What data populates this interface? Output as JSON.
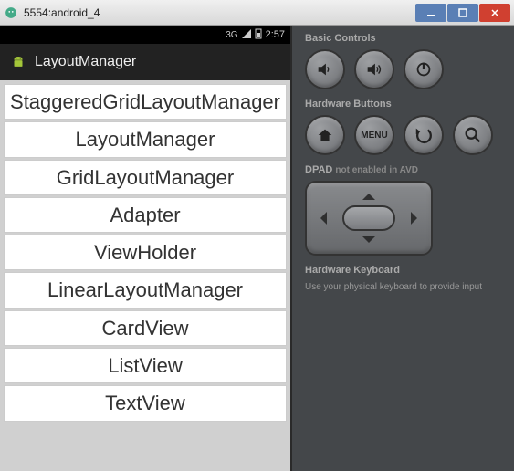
{
  "window": {
    "title": "5554:android_4"
  },
  "statusbar": {
    "signal": "3G",
    "time": "2:57"
  },
  "app": {
    "title": "LayoutManager"
  },
  "list": {
    "items": [
      "StaggeredGridLayoutManager",
      "LayoutManager",
      "GridLayoutManager",
      "Adapter",
      "ViewHolder",
      "LinearLayoutManager",
      "CardView",
      "ListView",
      "TextView"
    ]
  },
  "emulator": {
    "basic_controls_heading": "Basic Controls",
    "hardware_buttons_heading": "Hardware Buttons",
    "dpad_heading": "DPAD",
    "dpad_note": "not enabled in AVD",
    "keyboard_heading": "Hardware Keyboard",
    "keyboard_note": "Use your physical keyboard to provide input",
    "menu_label": "MENU"
  }
}
